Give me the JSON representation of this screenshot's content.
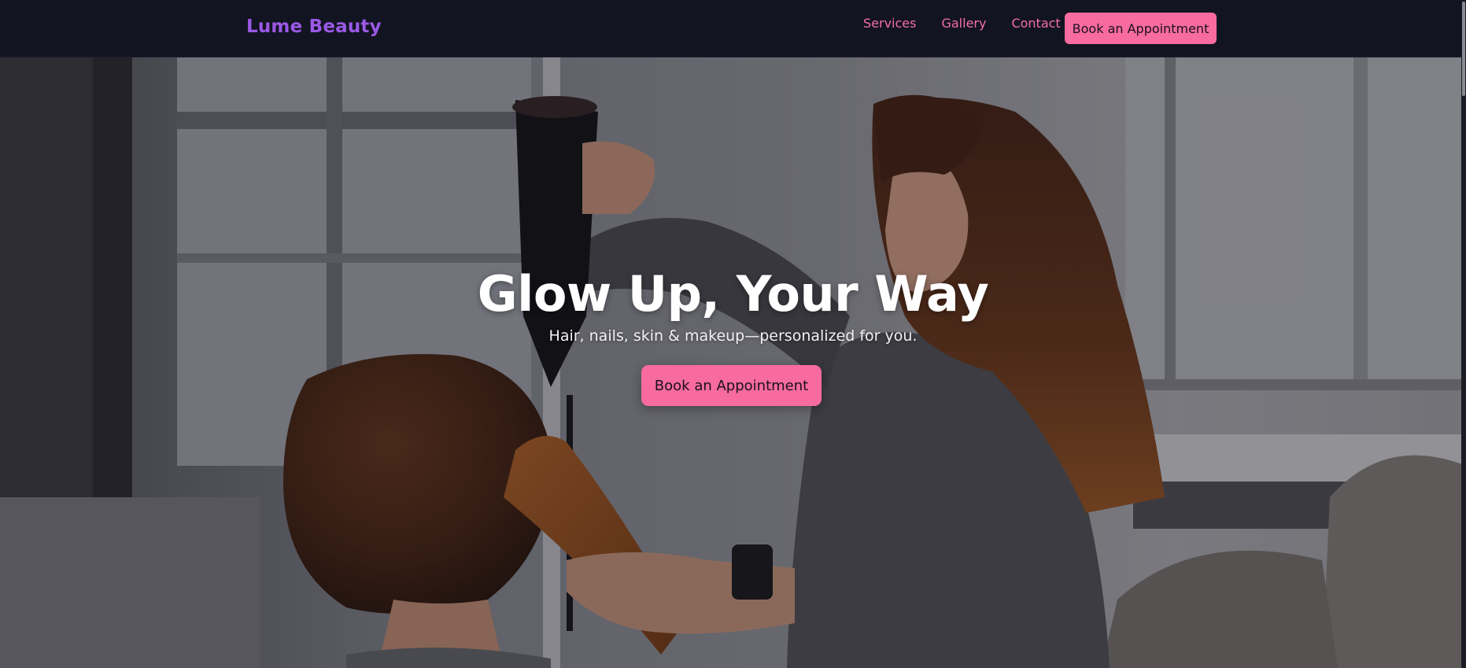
{
  "brand": {
    "name": "Lume Beauty"
  },
  "nav": {
    "links": [
      "Services",
      "Gallery",
      "Contact"
    ],
    "cta_label": "Book an Appointment"
  },
  "hero": {
    "title": "Glow Up, Your Way",
    "subtitle": "Hair, nails, skin & makeup—personalized for you.",
    "cta_label": "Book an Appointment"
  },
  "colors": {
    "nav_bg": "#131422",
    "brand": "#9b59e6",
    "accent": "#f76b9f",
    "nav_link": "#f36fa6"
  }
}
